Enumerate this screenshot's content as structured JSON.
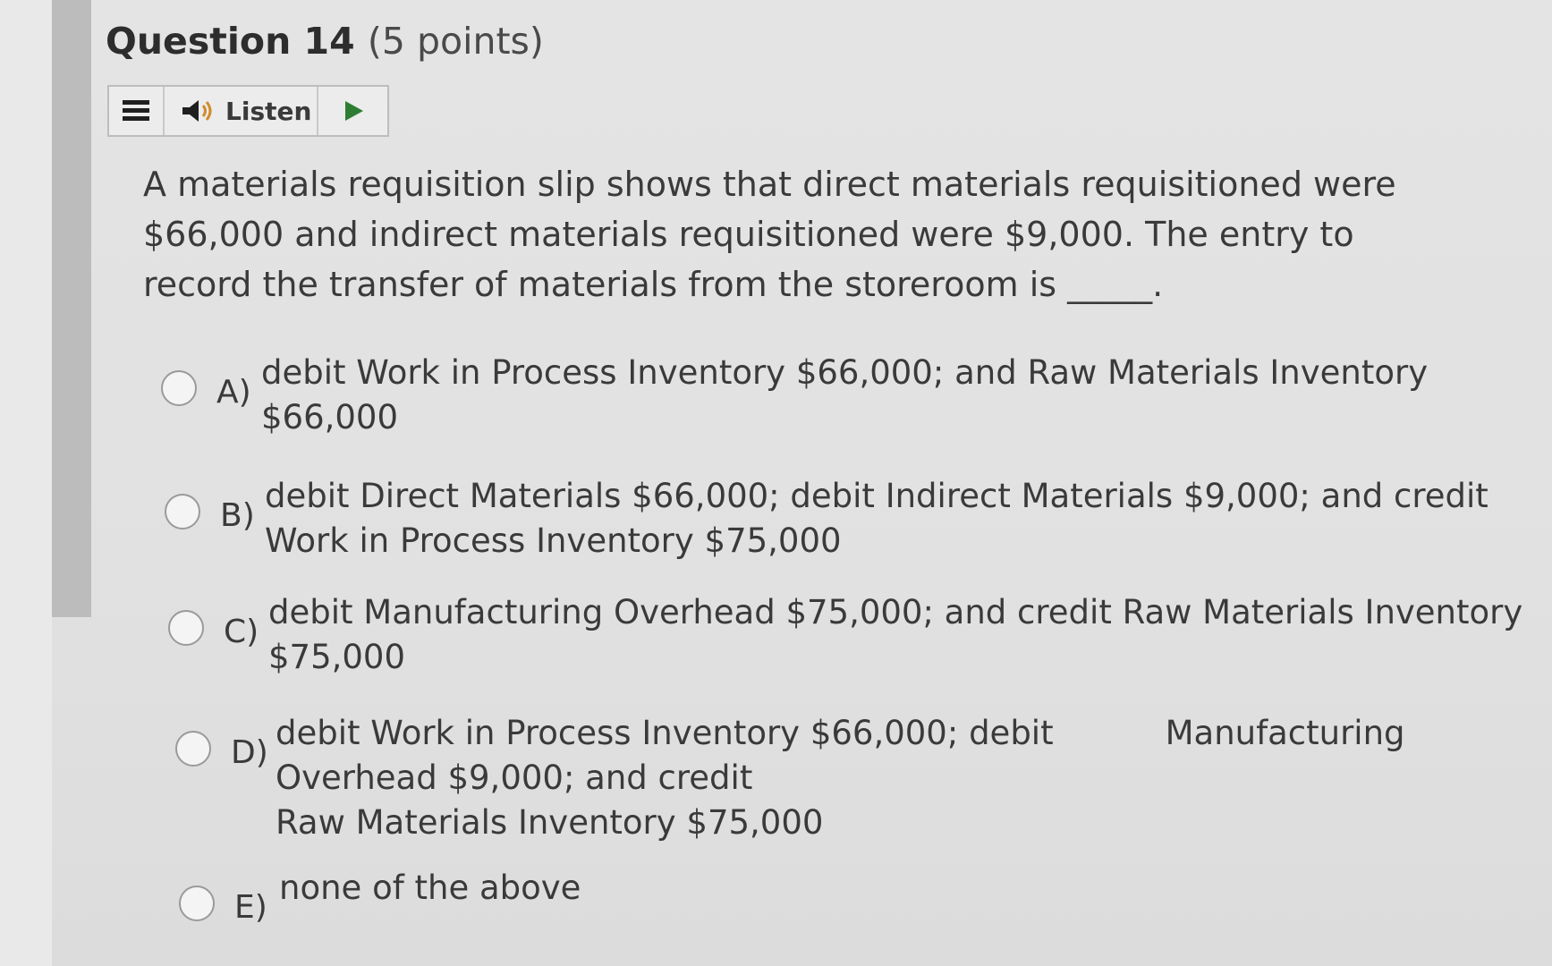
{
  "question": {
    "title": "Question 14",
    "points": "(5 points)",
    "stem": "A materials requisition slip shows that direct materials requisitioned were $66,000 and indirect materials requisitioned were $9,000. The entry to record the transfer of materials from the storeroom is _____."
  },
  "toolbar": {
    "listen_label": "Listen",
    "menu_icon": "hamburger-menu-icon",
    "speaker_icon": "speaker-icon",
    "play_icon": "play-icon"
  },
  "options": [
    {
      "letter": "A)",
      "lines": [
        "debit Work in Process Inventory $66,000; and Raw Materials Inventory",
        "$66,000"
      ]
    },
    {
      "letter": "B)",
      "lines": [
        "debit Direct Materials $66,000; debit Indirect Materials $9,000; and credit",
        "Work in Process Inventory $75,000"
      ]
    },
    {
      "letter": "C)",
      "lines": [
        "debit Manufacturing Overhead $75,000; and credit Raw Materials Inventory",
        "$75,000"
      ]
    },
    {
      "letter": "D)",
      "line1_left": "debit Work in Process Inventory $66,000; debit",
      "line1_right": "Manufacturing",
      "lines": [
        "Overhead $9,000; and credit",
        "Raw Materials Inventory $75,000"
      ]
    },
    {
      "letter": "E)",
      "lines": [
        "none of the above"
      ]
    }
  ],
  "colors": {
    "play": "#2e7d32",
    "speaker": "#1f1f1f",
    "speaker_accent": "#d18b2c"
  }
}
